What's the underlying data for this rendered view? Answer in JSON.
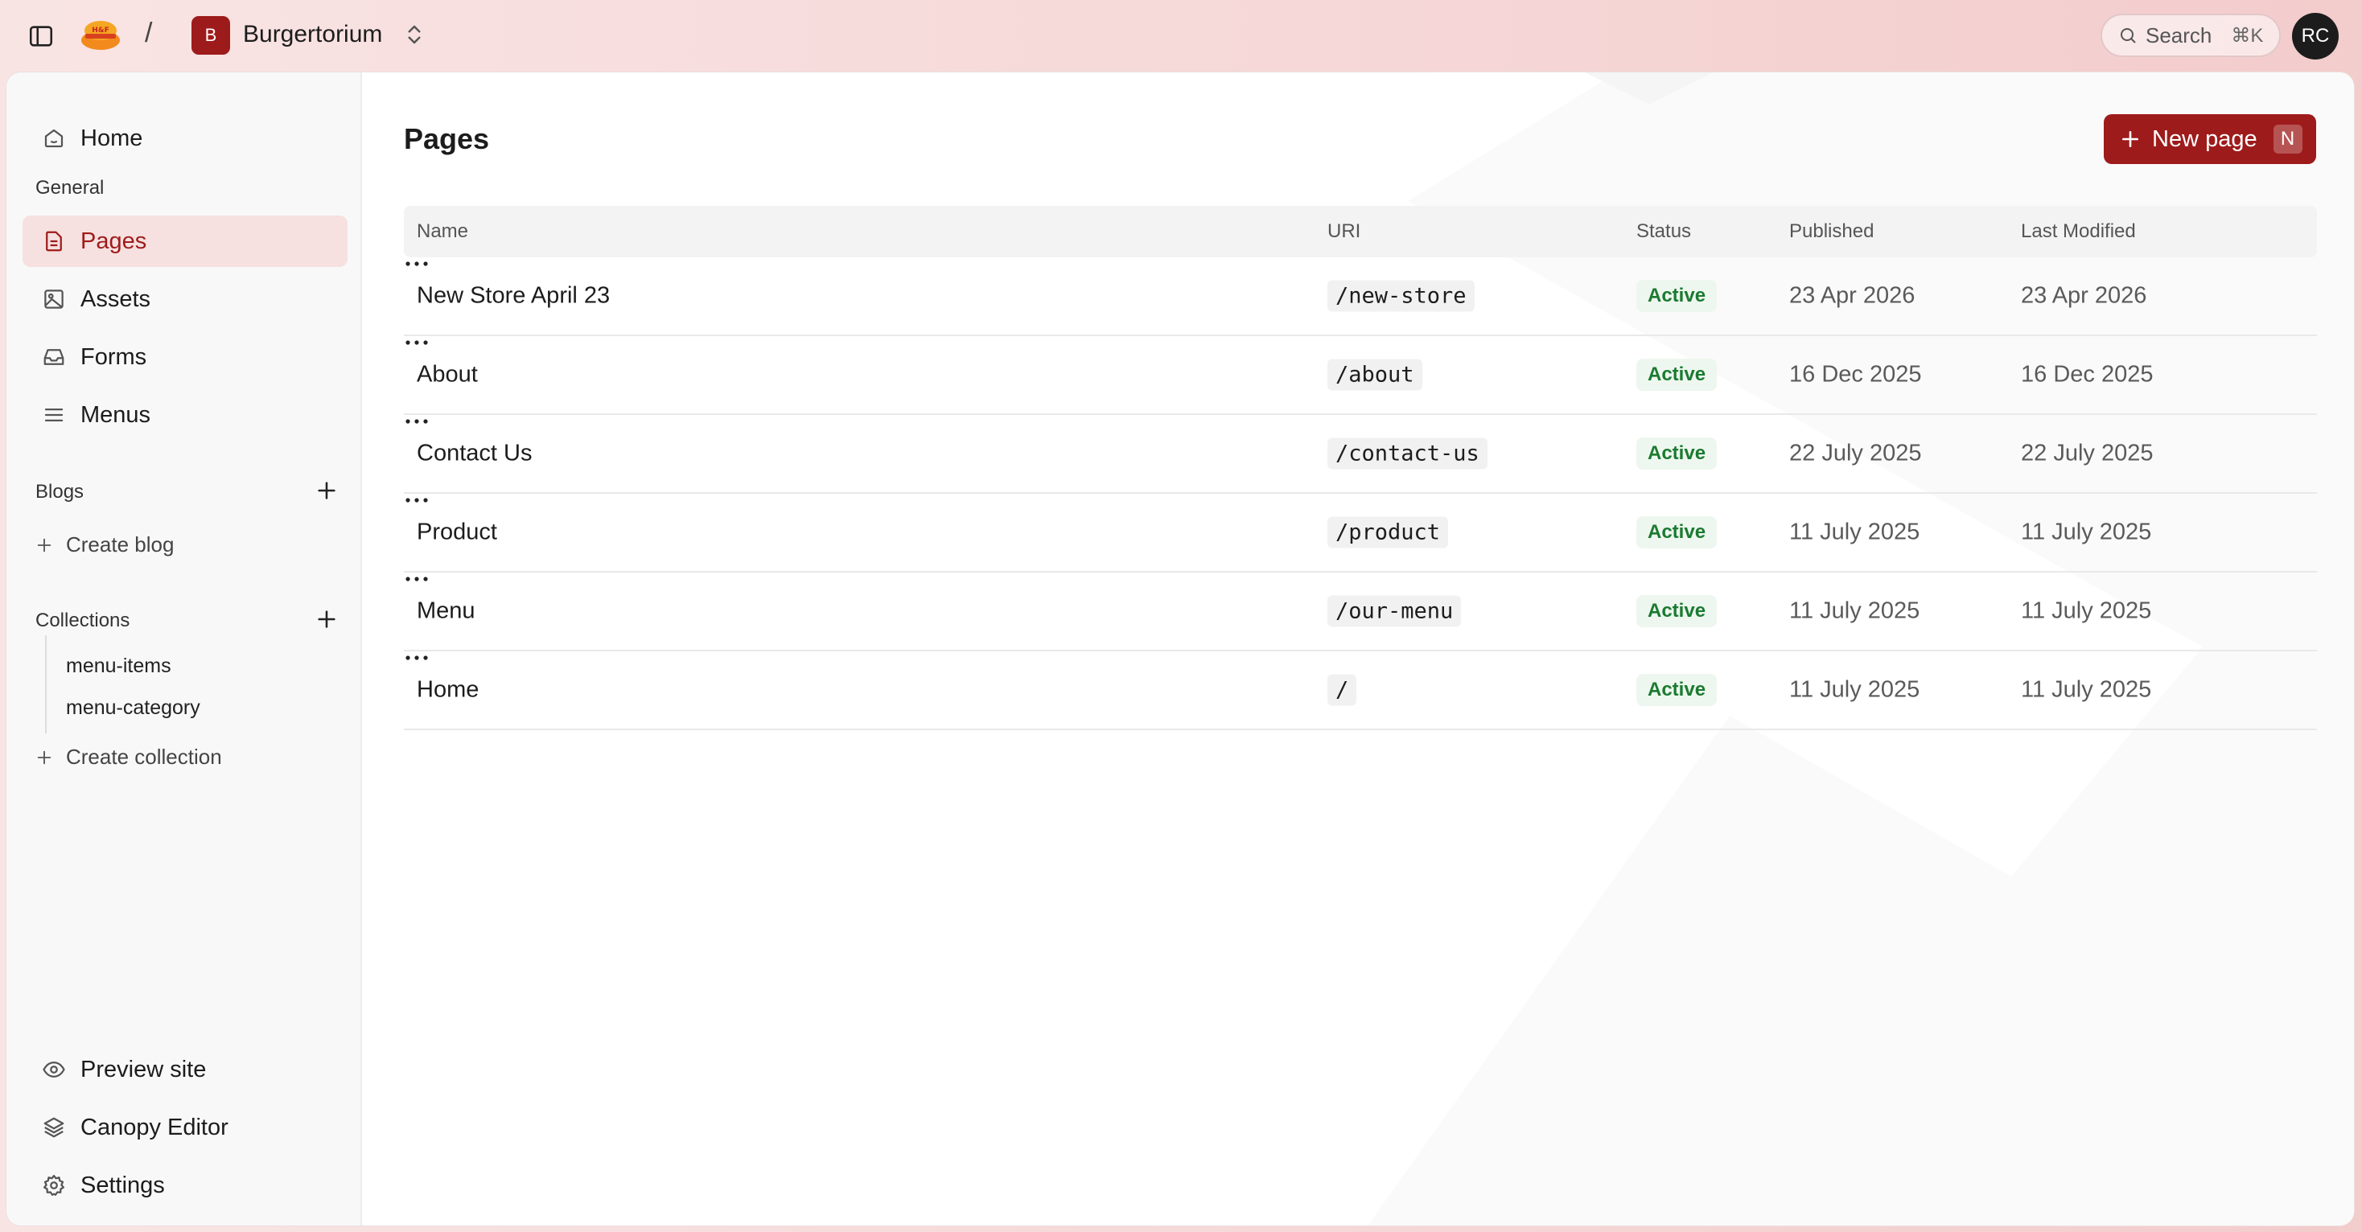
{
  "topbar": {
    "workspace_initial": "B",
    "workspace_name": "Burgertorium",
    "search_label": "Search",
    "search_shortcut": "⌘K",
    "avatar_initials": "RC",
    "logo_alt": "Hugh & Frank's logo"
  },
  "sidebar": {
    "home": "Home",
    "general_heading": "General",
    "general_items": [
      {
        "label": "Pages",
        "icon": "file-text-icon",
        "active": true
      },
      {
        "label": "Assets",
        "icon": "image-icon",
        "active": false
      },
      {
        "label": "Forms",
        "icon": "inbox-icon",
        "active": false
      },
      {
        "label": "Menus",
        "icon": "menu-lines-icon",
        "active": false
      }
    ],
    "blogs_heading": "Blogs",
    "create_blog": "Create blog",
    "collections_heading": "Collections",
    "collections": [
      "menu-items",
      "menu-category"
    ],
    "create_collection": "Create collection",
    "bottom_items": [
      {
        "label": "Preview site",
        "icon": "eye-icon"
      },
      {
        "label": "Canopy Editor",
        "icon": "layers-icon"
      },
      {
        "label": "Settings",
        "icon": "gear-icon"
      }
    ]
  },
  "main": {
    "title": "Pages",
    "new_button_label": "New page",
    "new_button_shortcut": "N",
    "columns": [
      "Name",
      "URI",
      "Status",
      "Published",
      "Last Modified"
    ],
    "rows": [
      {
        "name": "New Store April 23",
        "uri": "/new-store",
        "status": "Active",
        "published": "23 Apr 2026",
        "modified": "23 Apr 2026"
      },
      {
        "name": "About",
        "uri": "/about",
        "status": "Active",
        "published": "16 Dec 2025",
        "modified": "16 Dec 2025"
      },
      {
        "name": "Contact Us",
        "uri": "/contact-us",
        "status": "Active",
        "published": "22 July 2025",
        "modified": "22 July 2025"
      },
      {
        "name": "Product",
        "uri": "/product",
        "status": "Active",
        "published": "11 July 2025",
        "modified": "11 July 2025"
      },
      {
        "name": "Menu",
        "uri": "/our-menu",
        "status": "Active",
        "published": "11 July 2025",
        "modified": "11 July 2025"
      },
      {
        "name": "Home",
        "uri": "/",
        "status": "Active",
        "published": "11 July 2025",
        "modified": "11 July 2025"
      }
    ]
  },
  "colors": {
    "accent": "#9e1b1b",
    "active_bg": "#f7e0e0",
    "status_green": "#1b7a30"
  }
}
